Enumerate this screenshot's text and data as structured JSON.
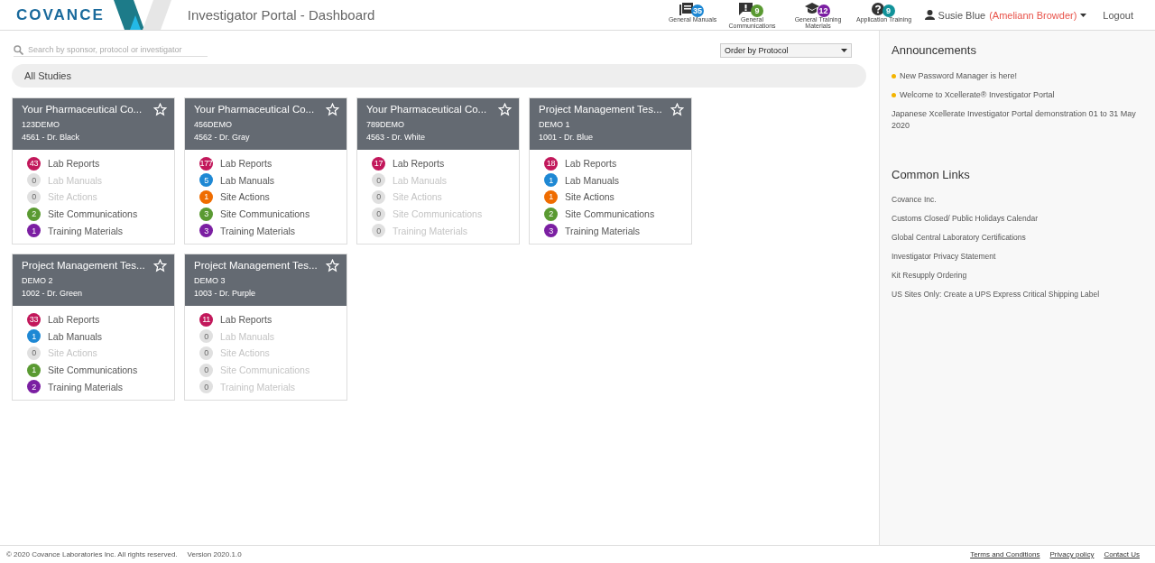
{
  "header": {
    "logo": "COVANCE",
    "title": "Investigator Portal - Dashboard",
    "nav": [
      {
        "label": "General Manuals",
        "count": "35",
        "color": "#1e88d4"
      },
      {
        "label": "General Communications",
        "count": "9",
        "color": "#5a9a32"
      },
      {
        "label": "General Training Materials",
        "count": "12",
        "color": "#7b1fa2"
      },
      {
        "label": "Application Training",
        "count": "9",
        "color": "#12939a"
      }
    ],
    "user": {
      "name": "Susie Blue",
      "delegate": "(Ameliann Browder)"
    },
    "logout": "Logout"
  },
  "toolbar": {
    "search": {
      "placeholder": "Search by sponsor, protocol or investigator"
    },
    "sort": "Order by Protocol"
  },
  "group": "All Studies",
  "studies": [
    {
      "title": "Your Pharmaceutical Co...",
      "protocol": "123DEMO",
      "site": "4561 - Dr. Black",
      "starred": false,
      "items": [
        {
          "count": "43",
          "label": "Lab Reports",
          "color": "#c2185b",
          "disabled": false
        },
        {
          "count": "0",
          "label": "Lab Manuals",
          "disabled": true
        },
        {
          "count": "0",
          "label": "Site Actions",
          "disabled": true
        },
        {
          "count": "2",
          "label": "Site Communications",
          "color": "#5a9a32",
          "disabled": false
        },
        {
          "count": "1",
          "label": "Training Materials",
          "color": "#7b1fa2",
          "disabled": false
        }
      ]
    },
    {
      "title": "Your Pharmaceutical Co...",
      "protocol": "456DEMO",
      "site": "4562 - Dr. Gray",
      "starred": false,
      "items": [
        {
          "count": "177",
          "label": "Lab Reports",
          "color": "#c2185b",
          "disabled": false
        },
        {
          "count": "5",
          "label": "Lab Manuals",
          "color": "#1e88d4",
          "disabled": false
        },
        {
          "count": "1",
          "label": "Site Actions",
          "color": "#ef6c00",
          "disabled": false
        },
        {
          "count": "3",
          "label": "Site Communications",
          "color": "#5a9a32",
          "disabled": false
        },
        {
          "count": "3",
          "label": "Training Materials",
          "color": "#7b1fa2",
          "disabled": false
        }
      ]
    },
    {
      "title": "Your Pharmaceutical Co...",
      "protocol": "789DEMO",
      "site": "4563 - Dr. White",
      "starred": false,
      "items": [
        {
          "count": "17",
          "label": "Lab Reports",
          "color": "#c2185b",
          "disabled": false
        },
        {
          "count": "0",
          "label": "Lab Manuals",
          "disabled": true
        },
        {
          "count": "0",
          "label": "Site Actions",
          "disabled": true
        },
        {
          "count": "0",
          "label": "Site Communications",
          "disabled": true
        },
        {
          "count": "0",
          "label": "Training Materials",
          "disabled": true
        }
      ]
    },
    {
      "title": "Project Management Tes...",
      "protocol": "DEMO 1",
      "site": "1001 - Dr. Blue",
      "starred": false,
      "items": [
        {
          "count": "18",
          "label": "Lab Reports",
          "color": "#c2185b",
          "disabled": false
        },
        {
          "count": "1",
          "label": "Lab Manuals",
          "color": "#1e88d4",
          "disabled": false
        },
        {
          "count": "1",
          "label": "Site Actions",
          "color": "#ef6c00",
          "disabled": false
        },
        {
          "count": "2",
          "label": "Site Communications",
          "color": "#5a9a32",
          "disabled": false
        },
        {
          "count": "3",
          "label": "Training Materials",
          "color": "#7b1fa2",
          "disabled": false
        }
      ]
    },
    {
      "title": "Project Management Tes...",
      "protocol": "DEMO 2",
      "site": "1002 - Dr. Green",
      "starred": false,
      "items": [
        {
          "count": "33",
          "label": "Lab Reports",
          "color": "#c2185b",
          "disabled": false
        },
        {
          "count": "1",
          "label": "Lab Manuals",
          "color": "#1e88d4",
          "disabled": false
        },
        {
          "count": "0",
          "label": "Site Actions",
          "disabled": true
        },
        {
          "count": "1",
          "label": "Site Communications",
          "color": "#5a9a32",
          "disabled": false
        },
        {
          "count": "2",
          "label": "Training Materials",
          "color": "#7b1fa2",
          "disabled": false
        }
      ]
    },
    {
      "title": "Project Management Tes...",
      "protocol": "DEMO 3",
      "site": "1003 - Dr. Purple",
      "starred": false,
      "items": [
        {
          "count": "11",
          "label": "Lab Reports",
          "color": "#c2185b",
          "disabled": false
        },
        {
          "count": "0",
          "label": "Lab Manuals",
          "disabled": true
        },
        {
          "count": "0",
          "label": "Site Actions",
          "disabled": true
        },
        {
          "count": "0",
          "label": "Site Communications",
          "disabled": true
        },
        {
          "count": "0",
          "label": "Training Materials",
          "disabled": true
        }
      ]
    }
  ],
  "sidebar": {
    "announcements_title": "Announcements",
    "announcements": [
      {
        "text": "New Password Manager is here!",
        "kind": "bullet"
      },
      {
        "text": "Welcome to Xcellerate® Investigator Portal",
        "kind": "bullet"
      },
      {
        "text": "Japanese Xcellerate Investigator Portal demonstration 01 to 31 May 2020",
        "kind": "plain"
      }
    ],
    "links_title": "Common Links",
    "links": [
      "Covance Inc.",
      "Customs Closed/ Public Holidays Calendar",
      "Global Central Laboratory Certifications",
      "Investigator Privacy Statement",
      "Kit Resupply Ordering",
      "US Sites Only: Create a UPS Express Critical Shipping Label"
    ]
  },
  "footer": {
    "copyright": "© 2020 Covance Laboratories Inc. All rights reserved.",
    "version": "Version 2020.1.0",
    "links": [
      "Terms and Conditions",
      "Privacy policy",
      "Contact Us"
    ]
  }
}
